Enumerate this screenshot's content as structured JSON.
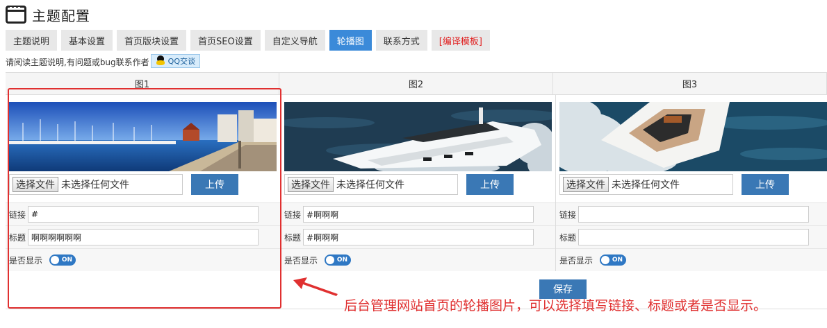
{
  "header": {
    "title": "主题配置",
    "icon": "window-icon"
  },
  "tabs": [
    {
      "label": "主题说明"
    },
    {
      "label": "基本设置"
    },
    {
      "label": "首页版块设置"
    },
    {
      "label": "首页SEO设置"
    },
    {
      "label": "自定义导航"
    },
    {
      "label": "轮播图",
      "active": true
    },
    {
      "label": "联系方式"
    },
    {
      "label": "[编译模板]"
    }
  ],
  "notice": {
    "text": "请阅读主题说明,有问题或bug联系作者",
    "qq_button": "QQ交谈",
    "qq_icon": "qq-penguin-icon"
  },
  "slides": [
    {
      "heading": "图1",
      "choose_label": "选择文件",
      "file_status": "未选择任何文件",
      "upload_label": "上传",
      "link_label": "链接",
      "link_value": "#",
      "title_label": "标题",
      "title_value": "啊啊啊啊啊啊",
      "show_label": "是否显示",
      "toggle_text": "ON",
      "image_desc": "harbor-panorama"
    },
    {
      "heading": "图2",
      "choose_label": "选择文件",
      "file_status": "未选择任何文件",
      "upload_label": "上传",
      "link_label": "链接",
      "link_value": "#啊啊啊",
      "title_label": "标题",
      "title_value": "#啊啊啊",
      "show_label": "是否显示",
      "toggle_text": "ON",
      "image_desc": "yacht-side"
    },
    {
      "heading": "图3",
      "choose_label": "选择文件",
      "file_status": "未选择任何文件",
      "upload_label": "上传",
      "link_label": "链接",
      "link_value": "",
      "title_label": "标题",
      "title_value": "",
      "show_label": "是否显示",
      "toggle_text": "ON",
      "image_desc": "yacht-top"
    }
  ],
  "save_label": "保存",
  "annotation": "后台管理网站首页的轮播图片，可以选择填写链接、标题或者是否显示。",
  "colors": {
    "accent": "#3b8ad9",
    "button": "#3a78b5",
    "annotation": "#e03030",
    "tab_bg": "#e8e8e8"
  }
}
